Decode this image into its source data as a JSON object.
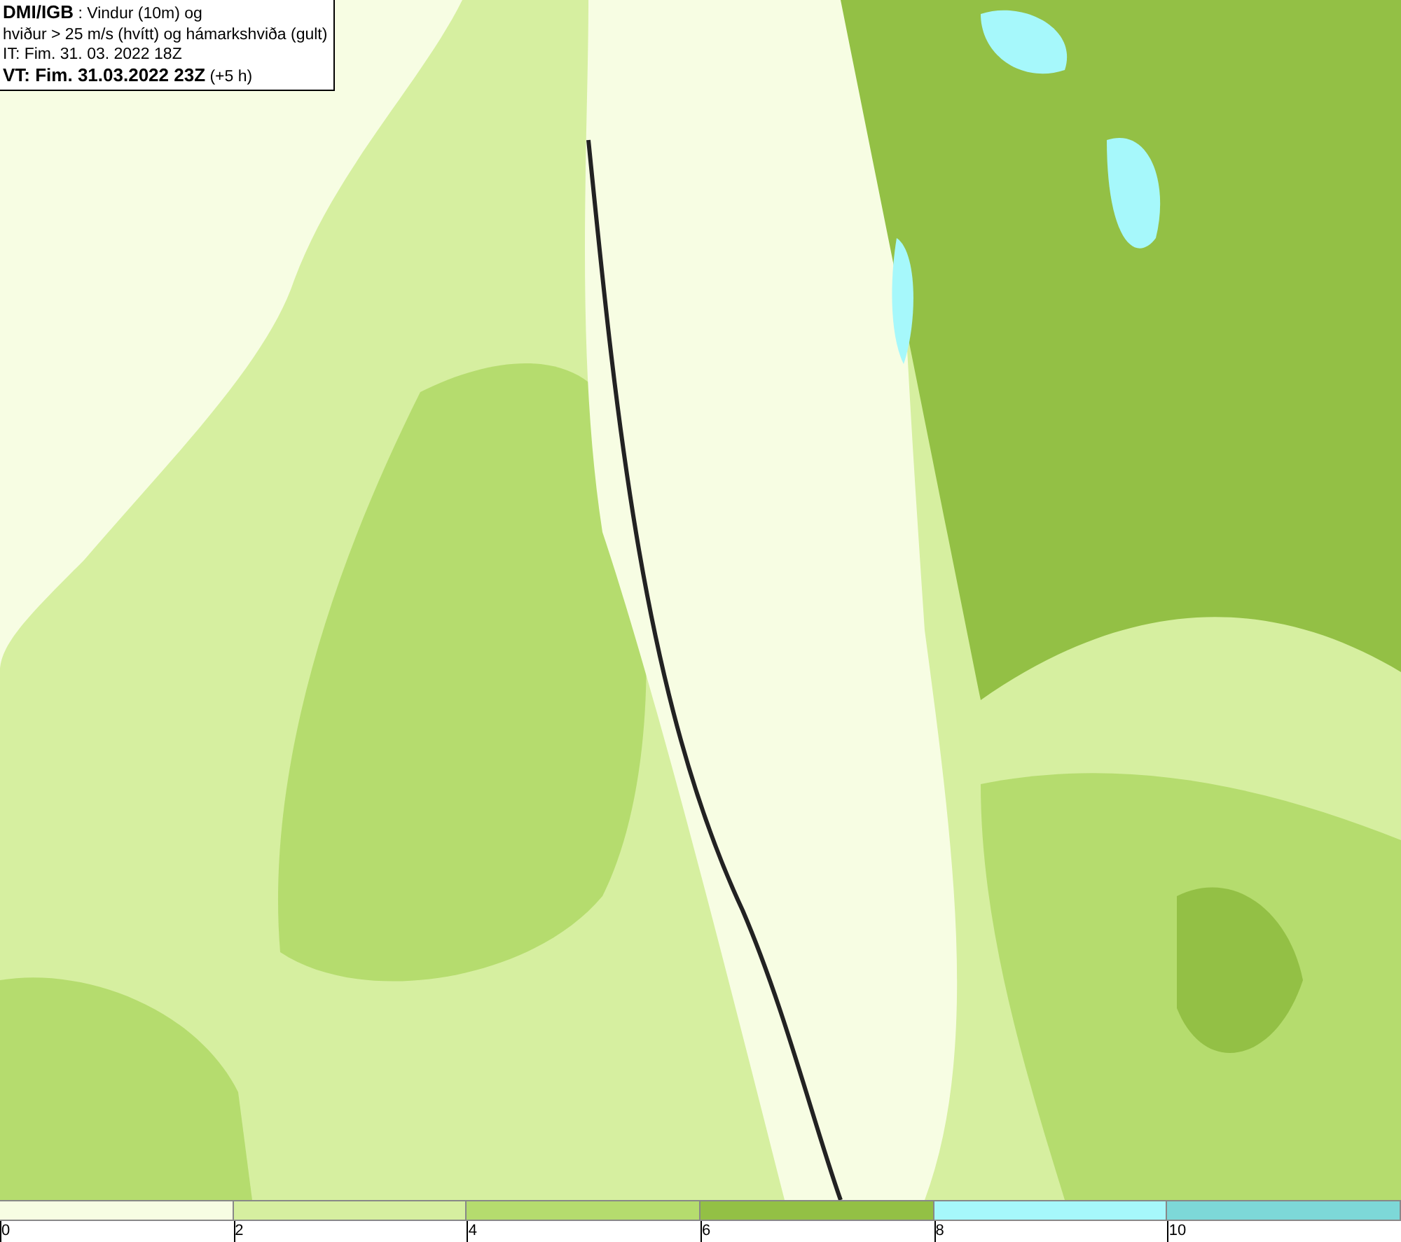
{
  "title_box": {
    "lines": [
      "**DMI/IGB** : Vindur (10m) og",
      "hviður > 25 m/s (hvítt) og hámarkshviða (gult)",
      "IT: Fim. 31. 03. 2022 18Z",
      "**VT: Fim. 31.03.2022 23Z** (+5 h)"
    ]
  },
  "legend": {
    "segments": [
      {
        "color": "#f7fde3"
      },
      {
        "color": "#d6efa0"
      },
      {
        "color": "#b5dc6e"
      },
      {
        "color": "#93c045"
      },
      {
        "color": "#a6f8fb"
      },
      {
        "color": "#7dd8d8"
      }
    ],
    "labels": [
      "0",
      "2",
      "4",
      "6",
      "8",
      "10"
    ]
  }
}
